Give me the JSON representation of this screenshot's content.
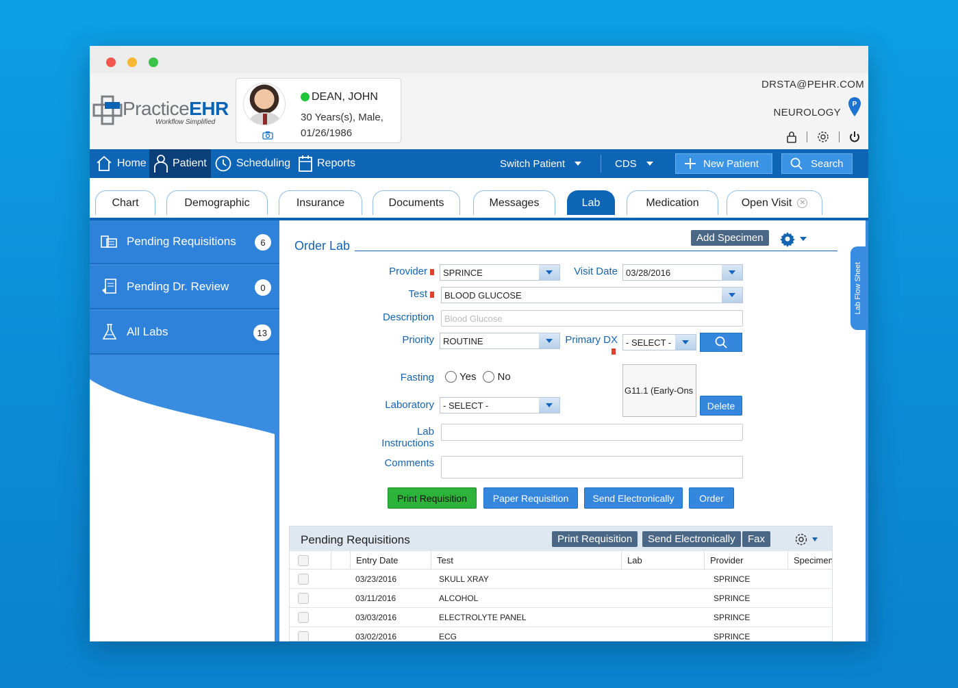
{
  "logo": {
    "name_light": "Practice",
    "name_bold": "EHR",
    "tagline": "Workflow Simplified"
  },
  "patient": {
    "name": "DEAN, JOHN",
    "details": "30 Years(s), Male,",
    "dob": "01/26/1986",
    "status_color": "#22c53a"
  },
  "user": {
    "email": "DRSTA@PEHR.COM",
    "department": "NEUROLOGY"
  },
  "nav": {
    "home": "Home",
    "patient": "Patient",
    "scheduling": "Scheduling",
    "reports": "Reports",
    "switch_patient": "Switch Patient",
    "cds": "CDS",
    "new_patient": "New Patient",
    "search": "Search"
  },
  "tabs": [
    "Chart",
    "Demographic",
    "Insurance",
    "Documents",
    "Messages",
    "Lab",
    "Medication",
    "Open Visit"
  ],
  "active_tab": "Lab",
  "sidebar": {
    "items": [
      {
        "label": "Pending Requisitions",
        "count": "6"
      },
      {
        "label": "Pending Dr. Review",
        "count": "0"
      },
      {
        "label": "All Labs",
        "count": "13"
      }
    ]
  },
  "order_lab": {
    "title": "Order Lab",
    "add_specimen": "Add Specimen",
    "flow_sheet": "Lab Flow Sheet",
    "labels": {
      "provider": "Provider",
      "visit_date": "Visit Date",
      "test": "Test",
      "description": "Description",
      "priority": "Priority",
      "primary_dx": "Primary DX",
      "fasting": "Fasting",
      "laboratory": "Laboratory",
      "lab_instructions_1": "Lab",
      "lab_instructions_2": "Instructions",
      "comments": "Comments",
      "yes": "Yes",
      "no": "No"
    },
    "values": {
      "provider": "SPRINCE",
      "visit_date": "03/28/2016",
      "test": "BLOOD GLUCOSE",
      "description_placeholder": "Blood Glucose",
      "priority": "ROUTINE",
      "primary_dx": "- SELECT -",
      "laboratory": "- SELECT -",
      "dx_selected": "G11.1 (Early-Ons"
    },
    "buttons": {
      "delete": "Delete",
      "print_requisition": "Print Requisition",
      "paper_requisition": "Paper Requisition",
      "send_electronically": "Send Electronically",
      "order": "Order"
    }
  },
  "pending_requisitions": {
    "title": "Pending Requisitions",
    "buttons": {
      "print": "Print Requisition",
      "send": "Send Electronically",
      "fax": "Fax"
    },
    "columns": [
      "Entry Date",
      "Test",
      "Lab",
      "Provider",
      "Specimen"
    ],
    "rows": [
      {
        "date": "03/23/2016",
        "test": "SKULL XRAY",
        "lab": "",
        "provider": "SPRINCE"
      },
      {
        "date": "03/11/2016",
        "test": "ALCOHOL",
        "lab": "",
        "provider": "SPRINCE"
      },
      {
        "date": "03/03/2016",
        "test": "ELECTROLYTE PANEL",
        "lab": "",
        "provider": "SPRINCE"
      },
      {
        "date": "03/02/2016",
        "test": "ECG",
        "lab": "",
        "provider": "SPRINCE"
      }
    ]
  }
}
